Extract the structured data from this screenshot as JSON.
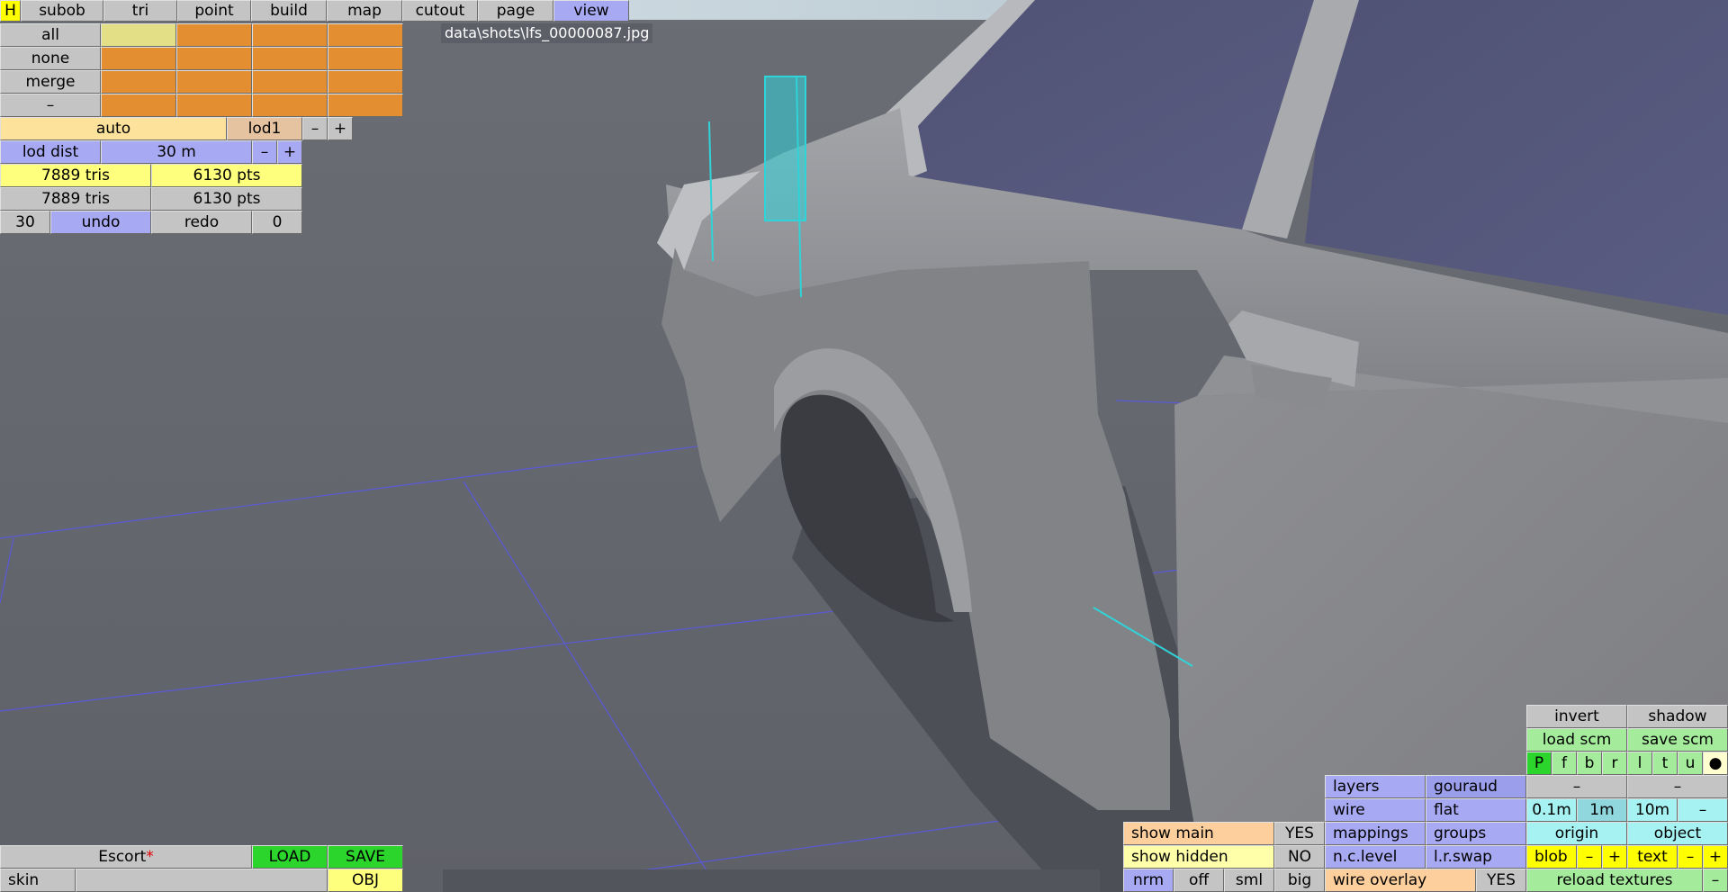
{
  "menu": {
    "items": [
      {
        "key": "h",
        "label": "H"
      },
      {
        "key": "subob",
        "label": "subob"
      },
      {
        "key": "tri",
        "label": "tri"
      },
      {
        "key": "point",
        "label": "point"
      },
      {
        "key": "build",
        "label": "build"
      },
      {
        "key": "map",
        "label": "map"
      },
      {
        "key": "cutout",
        "label": "cutout"
      },
      {
        "key": "page",
        "label": "page"
      },
      {
        "key": "view",
        "label": "view"
      }
    ],
    "active": "view"
  },
  "selection": {
    "all": "all",
    "none": "none",
    "merge": "merge",
    "minus": "–"
  },
  "lod": {
    "auto": "auto",
    "lod1": "lod1",
    "minus": "–",
    "plus": "+",
    "dist_label": "lod dist",
    "dist_value": "30 m",
    "dist_minus": "–",
    "dist_plus": "+"
  },
  "stats": {
    "row1_tris": "7889 tris",
    "row1_pts": "6130 pts",
    "row2_tris": "7889 tris",
    "row2_pts": "6130 pts"
  },
  "history": {
    "count": "30",
    "undo": "undo",
    "redo": "redo",
    "redo_count": "0"
  },
  "file_path": "data\\shots\\lfs_00000087.jpg",
  "project": {
    "name": "Escort",
    "modified_mark": "*",
    "load": "LOAD",
    "save": "SAVE",
    "skin": "skin",
    "obj": "OBJ"
  },
  "view_panel": {
    "invert": "invert",
    "shadow": "shadow",
    "load_scm": "load scm",
    "save_scm": "save scm",
    "views": [
      "P",
      "f",
      "b",
      "r",
      "l",
      "t",
      "u",
      "●"
    ],
    "minus1": "–",
    "minus2": "–",
    "layers": "layers",
    "gouraud": "gouraud",
    "wire": "wire",
    "flat": "flat",
    "grid": [
      "0.1m",
      "1m",
      "10m",
      "–"
    ],
    "mappings": "mappings",
    "groups": "groups",
    "origin": "origin",
    "object": "object",
    "nclevel": "n.c.level",
    "lrswap": "l.r.swap",
    "blob": "blob",
    "blob_minus": "–",
    "blob_plus": "+",
    "text": "text",
    "text_minus": "–",
    "text_plus": "+",
    "show_main": "show main",
    "show_main_value": "YES",
    "show_hidden": "show hidden",
    "show_hidden_value": "NO",
    "normals": [
      "nrm",
      "off",
      "sml",
      "big"
    ],
    "wire_overlay": "wire overlay",
    "wire_overlay_value": "YES",
    "reload_textures": "reload textures",
    "reload_minus": "–"
  },
  "colors": {
    "viewport": "#6e7078",
    "car_body": "#8d8e92",
    "grid_line": "#5a5ad8",
    "selection": "#2fd3d8"
  }
}
